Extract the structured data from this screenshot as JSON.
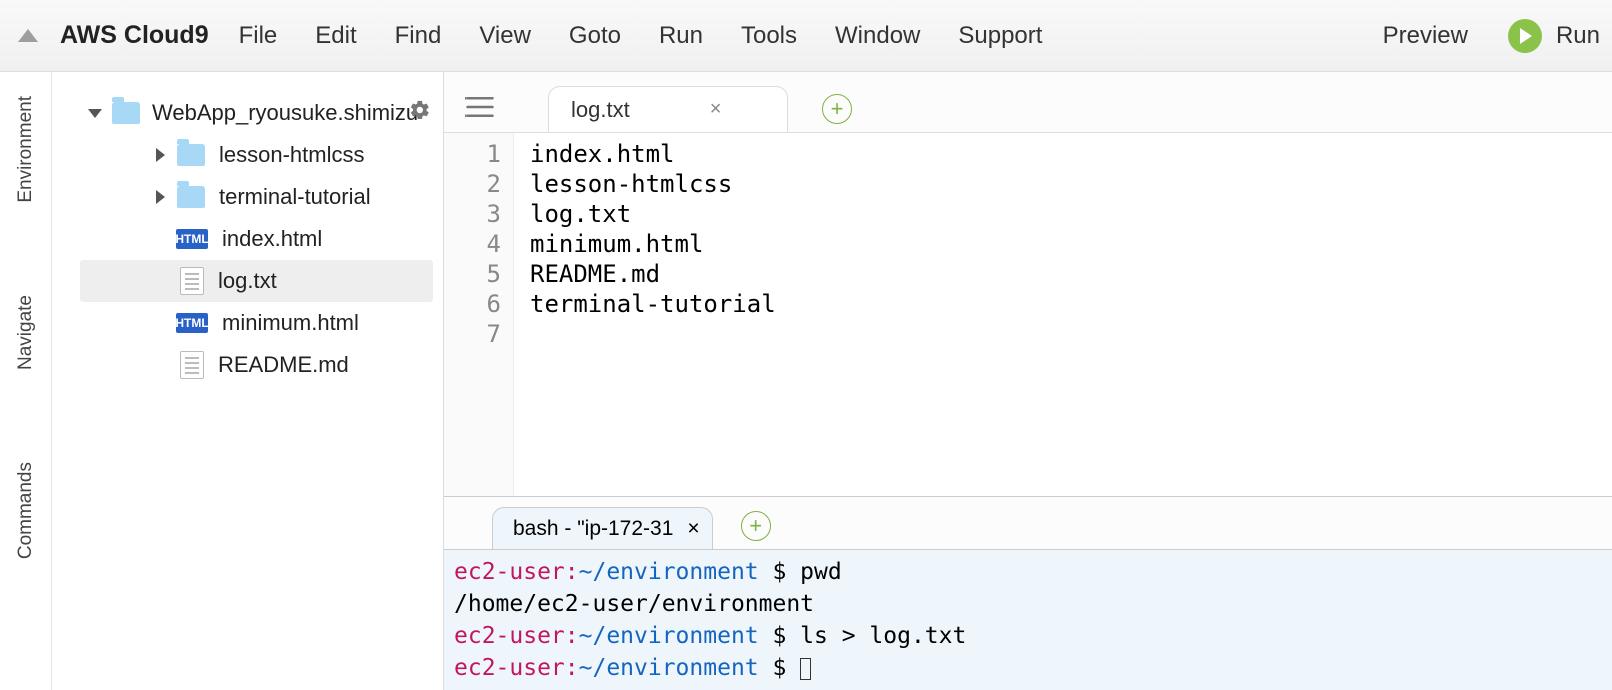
{
  "menubar": {
    "brand": "AWS Cloud9",
    "items": [
      "File",
      "Edit",
      "Find",
      "View",
      "Goto",
      "Run",
      "Tools",
      "Window",
      "Support"
    ],
    "preview": "Preview",
    "run": "Run"
  },
  "siderail": {
    "items": [
      "Environment",
      "Navigate",
      "Commands"
    ]
  },
  "tree": {
    "root": "WebApp_ryousuke.shimizu",
    "children": [
      {
        "type": "folder",
        "name": "lesson-htmlcss"
      },
      {
        "type": "folder",
        "name": "terminal-tutorial"
      },
      {
        "type": "html",
        "name": "index.html"
      },
      {
        "type": "txt",
        "name": "log.txt",
        "selected": true
      },
      {
        "type": "html",
        "name": "minimum.html"
      },
      {
        "type": "txt",
        "name": "README.md"
      }
    ],
    "html_badge": "HTML"
  },
  "editor": {
    "tab_label": "log.txt",
    "lines": [
      "index.html",
      "lesson-htmlcss",
      "log.txt",
      "minimum.html",
      "README.md",
      "terminal-tutorial",
      ""
    ],
    "gutter": [
      "1",
      "2",
      "3",
      "4",
      "5",
      "6",
      "7"
    ],
    "cursor_line_index": 6
  },
  "terminal": {
    "tab_label": "bash - \"ip-172-31",
    "prompt_user": "ec2-user:",
    "prompt_path": "~/environment",
    "prompt_sym": " $ ",
    "lines": [
      {
        "type": "cmd",
        "text": "pwd"
      },
      {
        "type": "out",
        "text": "/home/ec2-user/environment"
      },
      {
        "type": "cmd",
        "text": "ls > log.txt"
      },
      {
        "type": "cmd",
        "text": "",
        "cursor": true
      }
    ]
  }
}
